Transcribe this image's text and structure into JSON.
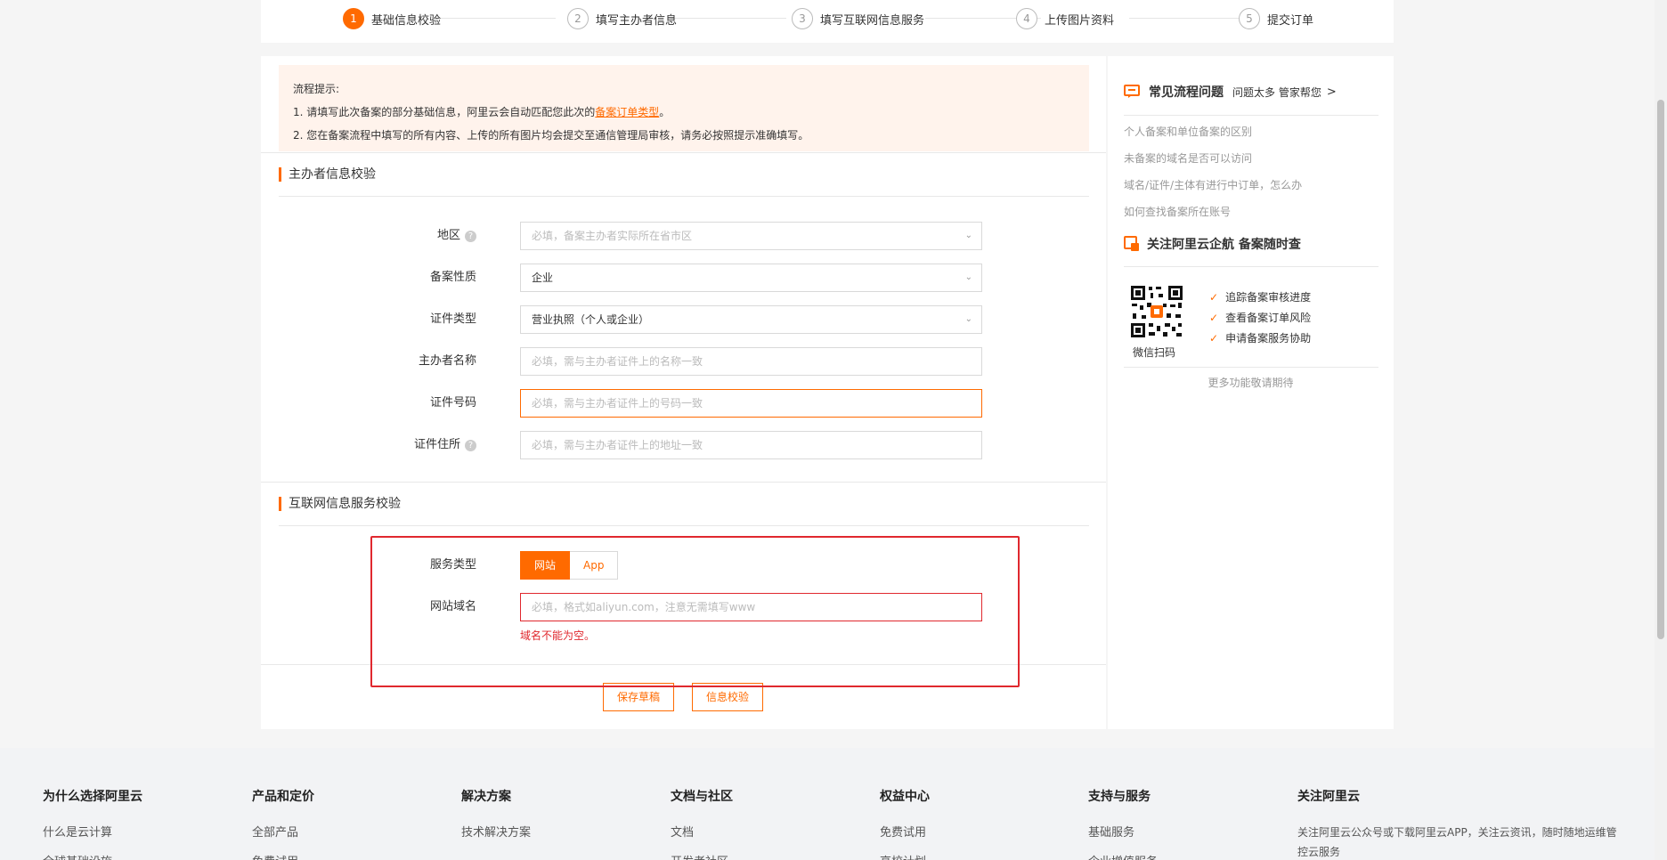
{
  "stepper": {
    "steps": [
      {
        "num": "1",
        "label": "基础信息校验"
      },
      {
        "num": "2",
        "label": "填写主办者信息"
      },
      {
        "num": "3",
        "label": "填写互联网信息服务"
      },
      {
        "num": "4",
        "label": "上传图片资料"
      },
      {
        "num": "5",
        "label": "提交订单"
      }
    ]
  },
  "notice": {
    "title": "流程提示:",
    "line1_prefix": "1. 请填写此次备案的部分基础信息，阿里云会自动匹配您此次的",
    "line1_link": "备案订单类型",
    "line1_suffix": "。",
    "line2": "2. 您在备案流程中填写的所有内容、上传的所有图片均会提交至通信管理局审核，请务必按照提示准确填写。"
  },
  "sponsor_section": {
    "title": "主办者信息校验",
    "region": {
      "label": "地区",
      "placeholder": "必填，备案主办者实际所在省市区"
    },
    "nature": {
      "label": "备案性质",
      "value": "企业"
    },
    "cert_type": {
      "label": "证件类型",
      "value": "营业执照（个人或企业）"
    },
    "sponsor_name": {
      "label": "主办者名称",
      "placeholder": "必填，需与主办者证件上的名称一致"
    },
    "cert_number": {
      "label": "证件号码",
      "placeholder": "必填，需与主办者证件上的号码一致"
    },
    "cert_address": {
      "label": "证件住所",
      "placeholder": "必填，需与主办者证件上的地址一致"
    }
  },
  "internet_section": {
    "title": "互联网信息服务校验",
    "service_type": {
      "label": "服务类型",
      "options": [
        "网站",
        "App"
      ],
      "selected": "网站"
    },
    "domain": {
      "label": "网站域名",
      "placeholder": "必填，格式如aliyun.com，注意无需填写www",
      "error": "域名不能为空。"
    }
  },
  "actions": {
    "save_draft": "保存草稿",
    "verify": "信息校验"
  },
  "side": {
    "faq_title": "常见流程问题",
    "faq_sub": "问题太多 管家帮您",
    "faq_links": [
      "个人备案和单位备案的区别",
      "未备案的域名是否可以访问",
      "域名/证件/主体有进行中订单，怎么办",
      "如何查找备案所在账号"
    ],
    "follow_title": "关注阿里云企航 备案随时查",
    "qr_caption": "微信扫码",
    "features": [
      "追踪备案审核进度",
      "查看备案订单风险",
      "申请备案服务协助"
    ],
    "more": "更多功能敬请期待"
  },
  "footer": {
    "columns": [
      {
        "title": "为什么选择阿里云",
        "items": [
          "什么是云计算",
          "全球基础设施"
        ]
      },
      {
        "title": "产品和定价",
        "items": [
          "全部产品",
          "免费试用"
        ]
      },
      {
        "title": "解决方案",
        "items": [
          "技术解决方案"
        ]
      },
      {
        "title": "文档与社区",
        "items": [
          "文档",
          "开发者社区"
        ]
      },
      {
        "title": "权益中心",
        "items": [
          "免费试用",
          "高校计划"
        ]
      },
      {
        "title": "支持与服务",
        "items": [
          "基础服务",
          "企业增值服务"
        ]
      },
      {
        "title": "关注阿里云",
        "items": [
          "关注阿里云公众号或下载阿里云APP，关注云资讯，随时随地运维管控云服务"
        ]
      }
    ]
  },
  "colors": {
    "accent": "#ff6a00",
    "error": "#e0282e"
  }
}
